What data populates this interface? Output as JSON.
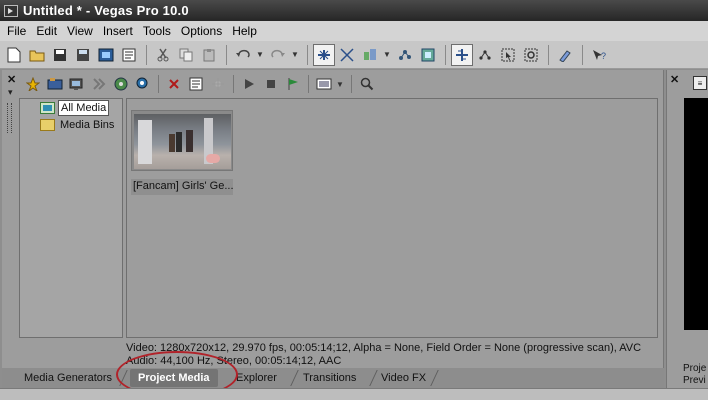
{
  "window": {
    "title": "Untitled * - Vegas Pro 10.0"
  },
  "menu": {
    "items": [
      "File",
      "Edit",
      "View",
      "Insert",
      "Tools",
      "Options",
      "Help"
    ]
  },
  "toolbar": {
    "icons": [
      "new-project",
      "open",
      "save",
      "save-as",
      "render-as",
      "properties",
      "cut",
      "copy",
      "paste",
      "undo",
      "redo",
      "enable-snapping",
      "auto-crossfades",
      "ripple-edit",
      "lock-envelopes",
      "ignore-event-grouping",
      "normal-edit-tool",
      "envelope-tool",
      "selection-tool",
      "zoom-tool",
      "erase-tool",
      "whats-this-help"
    ]
  },
  "project_media": {
    "tree": [
      {
        "label": "All Media",
        "selected": true
      },
      {
        "label": "Media Bins",
        "selected": false
      }
    ],
    "clips": [
      {
        "caption": "[Fancam] Girls' Ge..."
      }
    ],
    "info": {
      "video": "Video: 1280x720x12, 29.970 fps, 00:05:14;12, Alpha = None, Field Order = None (progressive scan), AVC",
      "audio": "Audio: 44,100 Hz, Stereo, 00:05:14;12, AAC"
    },
    "tabs": [
      {
        "label": "Media Generators",
        "active": false
      },
      {
        "label": "Project Media",
        "active": true
      },
      {
        "label": "Explorer",
        "active": false
      },
      {
        "label": "Transitions",
        "active": false
      },
      {
        "label": "Video FX",
        "active": false
      }
    ]
  },
  "right_panel": {
    "label_line1": "Proje",
    "label_line2": "Previ"
  },
  "colors": {
    "annotation": "#b1232a",
    "titlebar": "#262626",
    "active_tab": "#747474"
  }
}
